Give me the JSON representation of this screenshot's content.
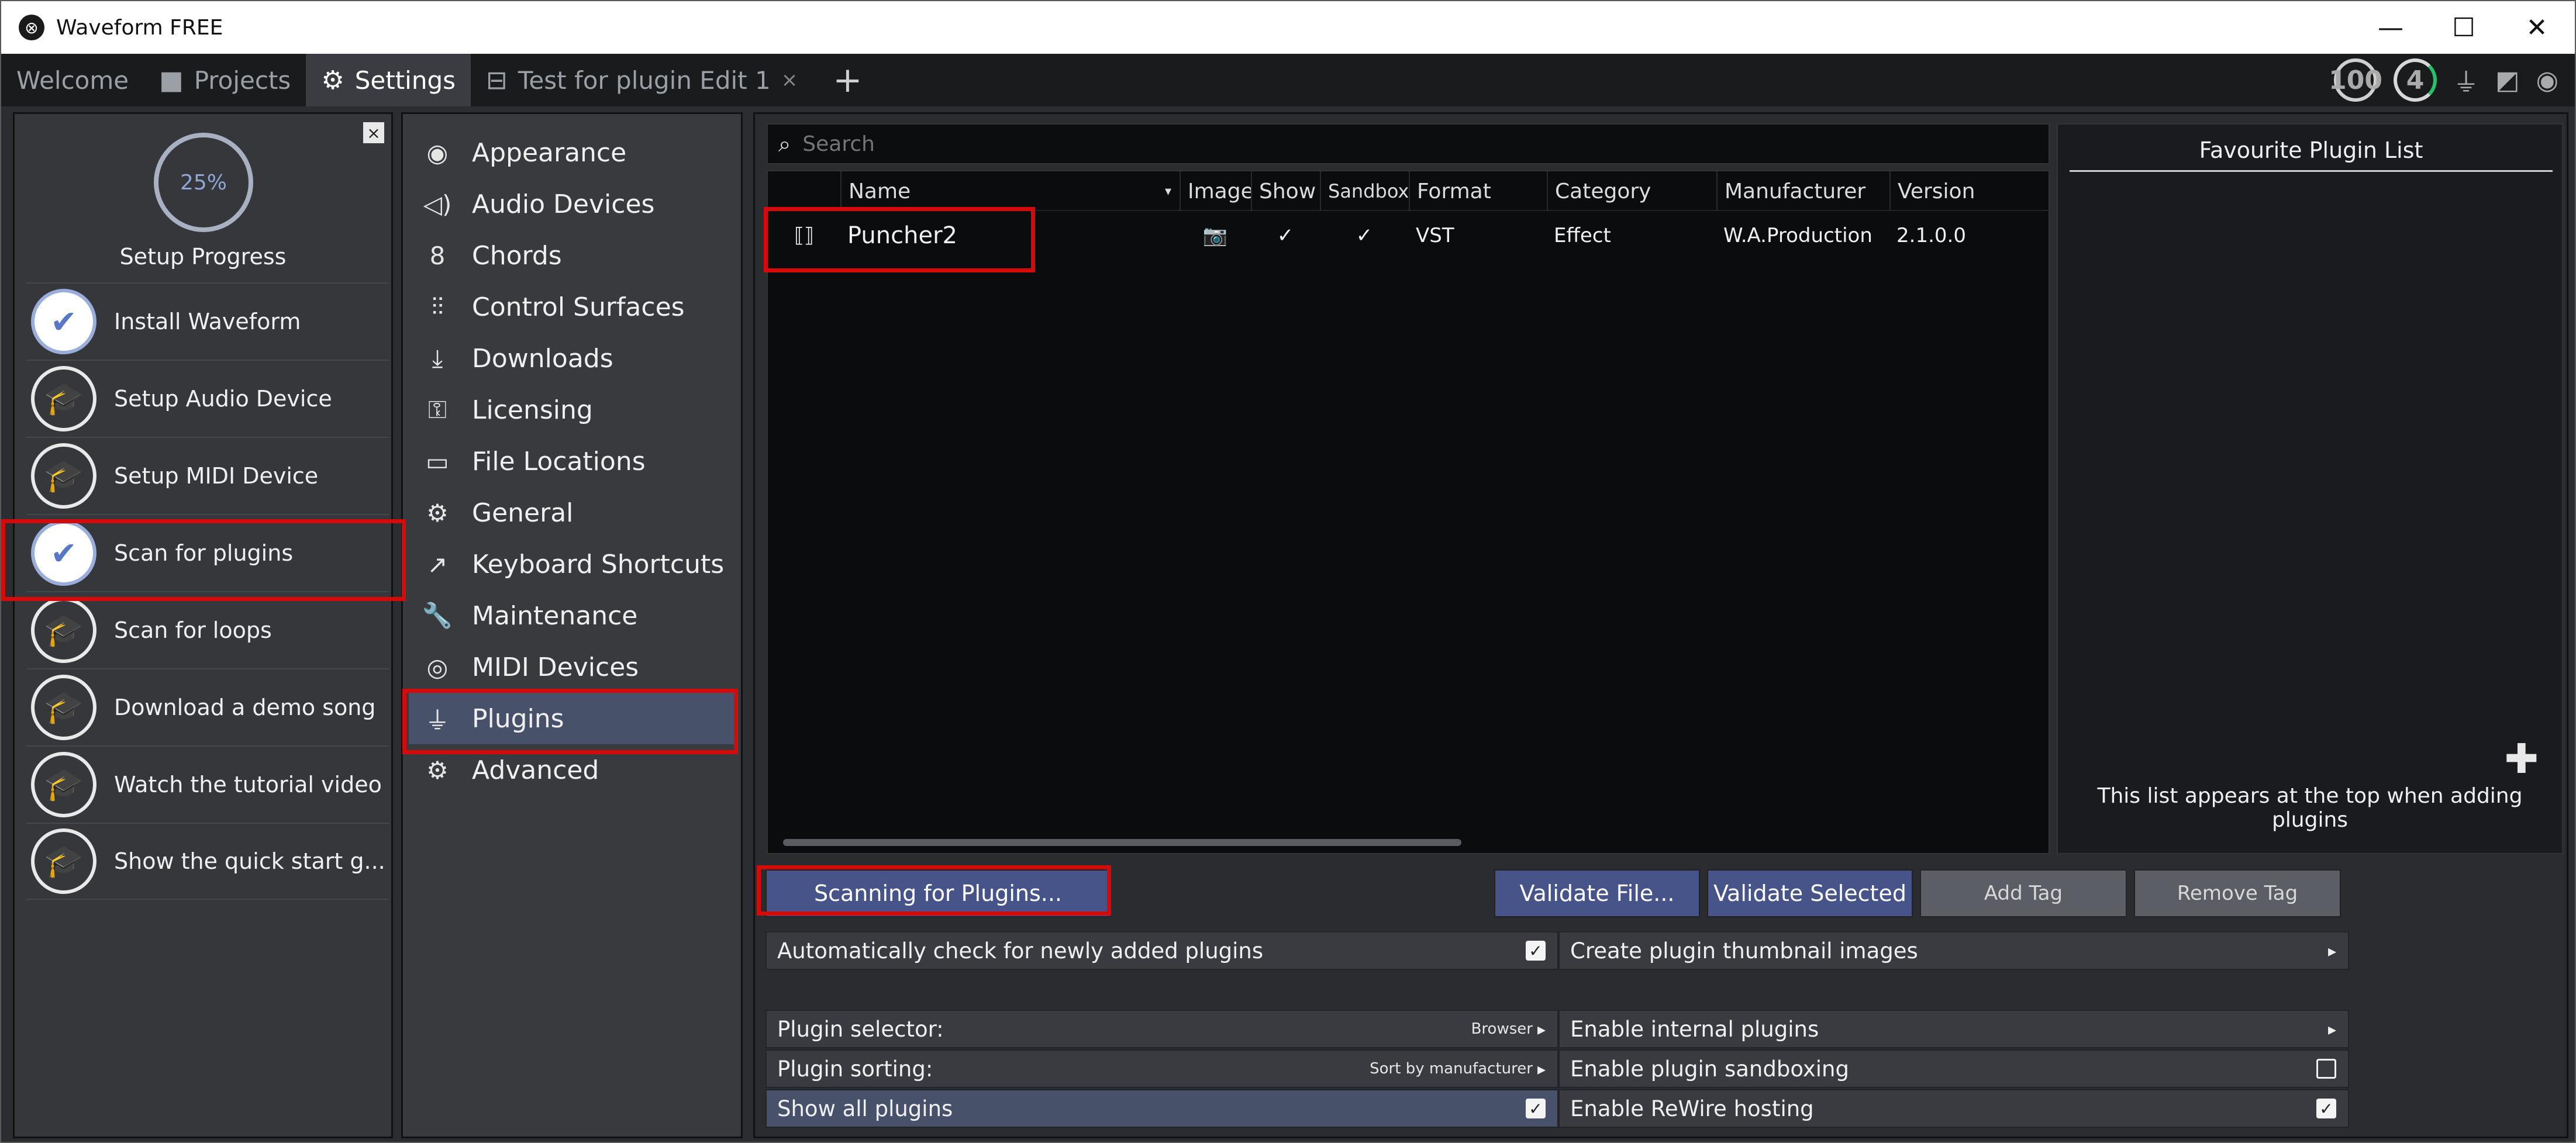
{
  "app": {
    "title": "Waveform FREE",
    "logo_glyph": "⊗"
  },
  "window_controls": {
    "minimize": "—",
    "maximize": "☐",
    "close": "✕"
  },
  "tabs": [
    {
      "label": "Welcome"
    },
    {
      "label": "Projects",
      "icon": "folder-icon"
    },
    {
      "label": "Settings",
      "icon": "gear-icon"
    },
    {
      "label": "Test for plugin Edit 1",
      "icon": "edit-icon",
      "close": "×"
    }
  ],
  "new_tab_label": "+",
  "top_right": {
    "gauge1": "100",
    "gauge2": "4"
  },
  "setup_progress": {
    "close": "×",
    "percent": "25%",
    "title": "Setup Progress",
    "steps": [
      {
        "label": "Install Waveform",
        "done": true
      },
      {
        "label": "Setup Audio Device",
        "done": false
      },
      {
        "label": "Setup MIDI Device",
        "done": false
      },
      {
        "label": "Scan for plugins",
        "done": true
      },
      {
        "label": "Scan for loops",
        "done": false
      },
      {
        "label": "Download a demo song",
        "done": false
      },
      {
        "label": "Watch the tutorial video",
        "done": false
      },
      {
        "label": "Show the quick start g...",
        "done": false
      }
    ]
  },
  "settings_menu": [
    {
      "label": "Appearance",
      "icon": "eye-icon"
    },
    {
      "label": "Audio Devices",
      "icon": "speaker-icon"
    },
    {
      "label": "Chords",
      "icon": "chords-icon"
    },
    {
      "label": "Control Surfaces",
      "icon": "sliders-icon"
    },
    {
      "label": "Downloads",
      "icon": "download-icon"
    },
    {
      "label": "Licensing",
      "icon": "key-icon"
    },
    {
      "label": "File Locations",
      "icon": "folder-icon"
    },
    {
      "label": "General",
      "icon": "gear-icon"
    },
    {
      "label": "Keyboard Shortcuts",
      "icon": "external-link-icon"
    },
    {
      "label": "Maintenance",
      "icon": "wrench-icon"
    },
    {
      "label": "MIDI Devices",
      "icon": "midi-icon"
    },
    {
      "label": "Plugins",
      "icon": "plug-icon",
      "active": true
    },
    {
      "label": "Advanced",
      "icon": "gear-icon"
    }
  ],
  "search": {
    "placeholder": "Search"
  },
  "plugin_table": {
    "columns": [
      "Name",
      "Image",
      "Show",
      "Sandbox",
      "Format",
      "Category",
      "Manufacturer",
      "Version"
    ],
    "rows": [
      {
        "name": "Puncher2",
        "image": "📷",
        "show": "✓",
        "sandbox": "✓",
        "format": "VST",
        "category": "Effect",
        "manufacturer": "W.A.Production",
        "version": "2.1.0.0"
      }
    ]
  },
  "favourites": {
    "title": "Favourite Plugin List",
    "add": "✚",
    "note": "This list appears at the top when adding plugins"
  },
  "buttons": {
    "scan": "Scanning for Plugins...",
    "validate_file": "Validate File...",
    "validate_selected": "Validate Selected",
    "add_tag": "Add Tag",
    "remove_tag": "Remove Tag"
  },
  "props": {
    "auto_check": {
      "label": "Automatically check for newly added plugins",
      "checked": true
    },
    "thumbnails": {
      "label": "Create plugin thumbnail images"
    },
    "selector": {
      "label": "Plugin selector:",
      "value": "Browser"
    },
    "internal": {
      "label": "Enable internal plugins"
    },
    "sorting": {
      "label": "Plugin sorting:",
      "value": "Sort by manufacturer"
    },
    "sandboxing": {
      "label": "Enable plugin sandboxing",
      "checked": false
    },
    "show_all": {
      "label": "Show all plugins",
      "checked": true
    },
    "rewire": {
      "label": "Enable ReWire hosting",
      "checked": true
    }
  },
  "colors": {
    "accent_blue": "#46548a",
    "highlight_red": "#d50b0b",
    "active_row": "#47526a"
  }
}
